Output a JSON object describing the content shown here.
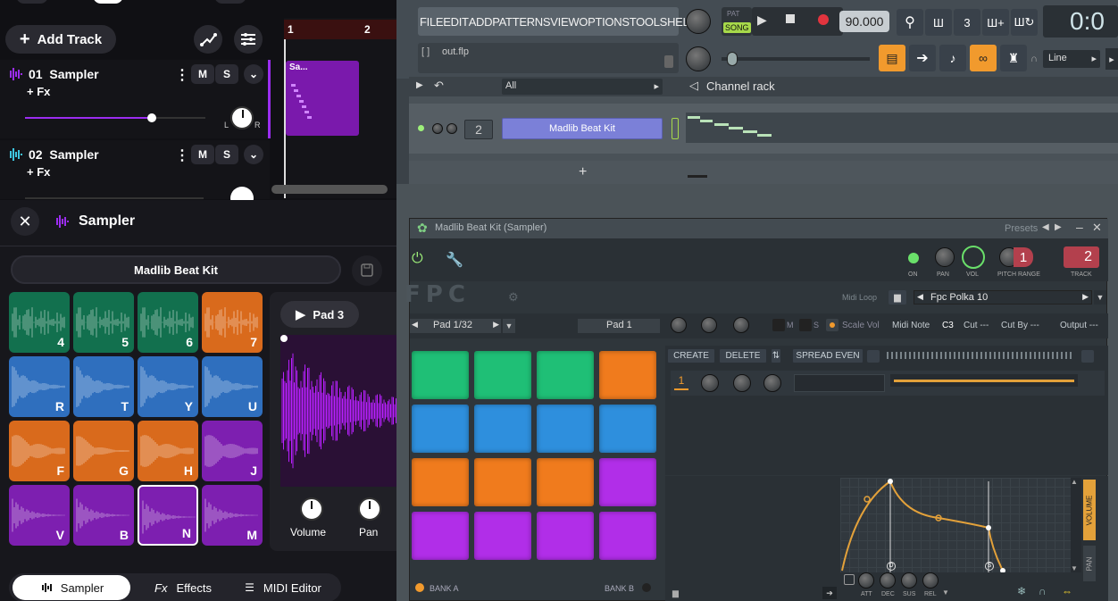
{
  "left": {
    "add_track": "Add Track",
    "tracks": [
      {
        "number": "01",
        "name": "Sampler",
        "fx": "+ Fx",
        "mute": "M",
        "solo": "S"
      },
      {
        "number": "02",
        "name": "Sampler",
        "fx": "+ Fx",
        "mute": "M",
        "solo": "S"
      }
    ],
    "timeline": {
      "marks": [
        "1",
        "2"
      ],
      "clip_label": "Sa..."
    },
    "pan_labels": {
      "l": "L",
      "r": "R"
    },
    "sampler": {
      "title": "Sampler",
      "kit": "Madlib Beat Kit",
      "pad_title": "Pad 3",
      "volume": "Volume",
      "pan": "Pan"
    },
    "pads": [
      {
        "key": "4",
        "color": "#12704e"
      },
      {
        "key": "5",
        "color": "#12704e"
      },
      {
        "key": "6",
        "color": "#12704e"
      },
      {
        "key": "7",
        "color": "#d96a1c"
      },
      {
        "key": "R",
        "color": "#2f6fbe"
      },
      {
        "key": "T",
        "color": "#2f6fbe"
      },
      {
        "key": "Y",
        "color": "#2f6fbe"
      },
      {
        "key": "U",
        "color": "#2f6fbe"
      },
      {
        "key": "F",
        "color": "#d96a1c"
      },
      {
        "key": "G",
        "color": "#d96a1c"
      },
      {
        "key": "H",
        "color": "#d96a1c"
      },
      {
        "key": "J",
        "color": "#7d1fb0"
      },
      {
        "key": "V",
        "color": "#7d1fb0"
      },
      {
        "key": "B",
        "color": "#7d1fb0"
      },
      {
        "key": "N",
        "color": "#7d1fb0"
      },
      {
        "key": "M",
        "color": "#7d1fb0"
      }
    ],
    "bottom_tabs": [
      {
        "label": "Sampler"
      },
      {
        "label": "Effects"
      },
      {
        "label": "MIDI Editor"
      }
    ],
    "colors": {
      "accent": "#9b2df0"
    }
  },
  "fl": {
    "menu": [
      "FILE",
      "EDIT",
      "ADD",
      "PATTERNS",
      "VIEW",
      "OPTIONS",
      "TOOLS",
      "HELP"
    ],
    "pat_label": "PAT",
    "song_label": "SONG",
    "tempo": "90.000",
    "time_display": "0:0",
    "file_name": "out.flp",
    "file_brackets": "[ ]",
    "line_mode": "Line",
    "channel_rack": {
      "filter": "All",
      "title": "Channel rack",
      "channel_number": "2",
      "channel_name": "Madlib Beat Kit",
      "add": "+"
    },
    "plugin": {
      "title": "Madlib Beat Kit (Sampler)",
      "presets": "Presets",
      "labels": {
        "on": "ON",
        "pan": "PAN",
        "vol": "VOL",
        "pitch": "PITCH",
        "range": "RANGE",
        "track": "TRACK"
      },
      "range_value": "1",
      "track_value": "2",
      "logo": "FPC",
      "midi_loop": "Midi Loop",
      "preset_name": "Fpc Polka 10",
      "pad_selector": "Pad 1/32",
      "pad_name": "Pad 1",
      "m_label": "M",
      "s_label": "S",
      "scale_vol": "Scale Vol",
      "midi_note": "Midi Note",
      "note_value": "C3",
      "cut": "Cut ---",
      "cut_by": "Cut By ---",
      "output": "Output ---",
      "create": "CREATE",
      "delete": "DELETE",
      "spread_even": "SPREAD EVEN",
      "layer_num": "1",
      "bank_a": "BANK A",
      "bank_b": "BANK B",
      "env_labels": [
        "ATT",
        "DEC",
        "SUS",
        "REL"
      ],
      "env_tabs": {
        "volume": "VOLUME",
        "pan": "PAN"
      },
      "env_point_d": "D",
      "env_point_s": "S"
    },
    "pad_colors": [
      "#1fbf76",
      "#1fbf76",
      "#1fbf76",
      "#f07b1d",
      "#2e8fdd",
      "#2e8fdd",
      "#2e8fdd",
      "#2e8fdd",
      "#f07b1d",
      "#f07b1d",
      "#f07b1d",
      "#b12ee8",
      "#b12ee8",
      "#b12ee8",
      "#b12ee8",
      "#b12ee8"
    ]
  }
}
